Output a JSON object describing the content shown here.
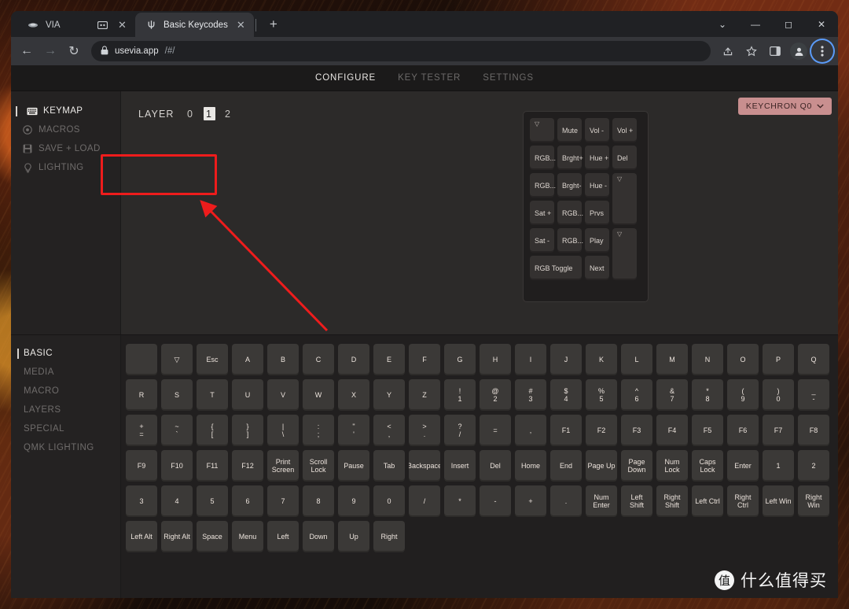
{
  "browser": {
    "tabs": [
      {
        "title": "VIA",
        "favicon": "via-icon",
        "active": false,
        "has_cast_icon": true
      },
      {
        "title": "Basic Keycodes",
        "favicon": "psi-icon",
        "active": true,
        "has_cast_icon": false
      }
    ],
    "newtab_label": "+",
    "window_controls": [
      "chevron-down",
      "minimize",
      "maximize",
      "close"
    ],
    "toolbar": {
      "back": "←",
      "forward": "→",
      "reload": "↻",
      "lock_icon": "lock-icon",
      "url_domain": "usevia.app",
      "url_path": "/#/",
      "share_icon": "share-icon",
      "star_icon": "star-icon",
      "panel_icon": "side-panel-icon",
      "profile_icon": "profile-avatar",
      "menu_icon": "three-dot-menu"
    }
  },
  "app": {
    "topnav": [
      {
        "label": "CONFIGURE",
        "active": true
      },
      {
        "label": "KEY TESTER",
        "active": false
      },
      {
        "label": "SETTINGS",
        "active": false
      }
    ],
    "sidebar": [
      {
        "label": "KEYMAP",
        "icon": "keyboard-icon",
        "active": true
      },
      {
        "label": "MACROS",
        "icon": "record-icon",
        "active": false
      },
      {
        "label": "SAVE + LOAD",
        "icon": "save-icon",
        "active": false
      },
      {
        "label": "LIGHTING",
        "icon": "bulb-icon",
        "active": false
      }
    ],
    "layer": {
      "label": "LAYER",
      "options": [
        "0",
        "1",
        "2"
      ],
      "selected": "1"
    },
    "keyboard_select": {
      "label": "KEYCHRON Q0",
      "chevron": "⌄",
      "color": "#c98f8f"
    },
    "keyboard_preview": {
      "keys": [
        {
          "label": "▽",
          "col": 0,
          "row": 0,
          "w": 1,
          "h": 1,
          "tiny": true
        },
        {
          "label": "Mute",
          "col": 1,
          "row": 0,
          "w": 1,
          "h": 1
        },
        {
          "label": "Vol -",
          "col": 2,
          "row": 0,
          "w": 1,
          "h": 1
        },
        {
          "label": "Vol +",
          "col": 3,
          "row": 0,
          "w": 1,
          "h": 1
        },
        {
          "label": "RGB...",
          "col": 0,
          "row": 1,
          "w": 1,
          "h": 1
        },
        {
          "label": "Brght+",
          "col": 1,
          "row": 1,
          "w": 1,
          "h": 1
        },
        {
          "label": "Hue +",
          "col": 2,
          "row": 1,
          "w": 1,
          "h": 1
        },
        {
          "label": "Del",
          "col": 3,
          "row": 1,
          "w": 1,
          "h": 1
        },
        {
          "label": "RGB...",
          "col": 0,
          "row": 2,
          "w": 1,
          "h": 1
        },
        {
          "label": "Brght-",
          "col": 1,
          "row": 2,
          "w": 1,
          "h": 1
        },
        {
          "label": "Hue -",
          "col": 2,
          "row": 2,
          "w": 1,
          "h": 1
        },
        {
          "label": "▽",
          "col": 3,
          "row": 2,
          "w": 1,
          "h": 2,
          "tiny": true
        },
        {
          "label": "Sat +",
          "col": 0,
          "row": 3,
          "w": 1,
          "h": 1
        },
        {
          "label": "RGB...",
          "col": 1,
          "row": 3,
          "w": 1,
          "h": 1
        },
        {
          "label": "Prvs",
          "col": 2,
          "row": 3,
          "w": 1,
          "h": 1
        },
        {
          "label": "Sat -",
          "col": 0,
          "row": 4,
          "w": 1,
          "h": 1
        },
        {
          "label": "RGB...",
          "col": 1,
          "row": 4,
          "w": 1,
          "h": 1
        },
        {
          "label": "Play",
          "col": 2,
          "row": 4,
          "w": 1,
          "h": 1
        },
        {
          "label": "▽",
          "col": 3,
          "row": 4,
          "w": 1,
          "h": 2,
          "tiny": true
        },
        {
          "label": "RGB Toggle",
          "col": 0,
          "row": 5,
          "w": 2,
          "h": 1
        },
        {
          "label": "Next",
          "col": 2,
          "row": 5,
          "w": 1,
          "h": 1
        }
      ]
    },
    "categories": [
      {
        "label": "BASIC",
        "active": true
      },
      {
        "label": "MEDIA",
        "active": false
      },
      {
        "label": "MACRO",
        "active": false
      },
      {
        "label": "LAYERS",
        "active": false
      },
      {
        "label": "SPECIAL",
        "active": false
      },
      {
        "label": "QMK LIGHTING",
        "active": false
      }
    ],
    "keycode_rows": [
      [
        {
          "top": "",
          "bottom": ""
        },
        {
          "top": "",
          "bottom": "▽"
        },
        {
          "top": "",
          "bottom": "Esc"
        },
        {
          "top": "",
          "bottom": "A"
        },
        {
          "top": "",
          "bottom": "B"
        },
        {
          "top": "",
          "bottom": "C"
        },
        {
          "top": "",
          "bottom": "D"
        },
        {
          "top": "",
          "bottom": "E"
        },
        {
          "top": "",
          "bottom": "F"
        },
        {
          "top": "",
          "bottom": "G"
        },
        {
          "top": "",
          "bottom": "H"
        },
        {
          "top": "",
          "bottom": "I"
        },
        {
          "top": "",
          "bottom": "J"
        },
        {
          "top": "",
          "bottom": "K"
        },
        {
          "top": "",
          "bottom": "L"
        },
        {
          "top": "",
          "bottom": "M"
        },
        {
          "top": "",
          "bottom": "N"
        },
        {
          "top": "",
          "bottom": "O"
        },
        {
          "top": "",
          "bottom": "P"
        },
        {
          "top": "",
          "bottom": "Q"
        }
      ],
      [
        {
          "top": "",
          "bottom": "R"
        },
        {
          "top": "",
          "bottom": "S"
        },
        {
          "top": "",
          "bottom": "T"
        },
        {
          "top": "",
          "bottom": "U"
        },
        {
          "top": "",
          "bottom": "V"
        },
        {
          "top": "",
          "bottom": "W"
        },
        {
          "top": "",
          "bottom": "X"
        },
        {
          "top": "",
          "bottom": "Y"
        },
        {
          "top": "",
          "bottom": "Z"
        },
        {
          "top": "!",
          "bottom": "1"
        },
        {
          "top": "@",
          "bottom": "2"
        },
        {
          "top": "#",
          "bottom": "3"
        },
        {
          "top": "$",
          "bottom": "4"
        },
        {
          "top": "%",
          "bottom": "5"
        },
        {
          "top": "^",
          "bottom": "6"
        },
        {
          "top": "&",
          "bottom": "7"
        },
        {
          "top": "*",
          "bottom": "8"
        },
        {
          "top": "(",
          "bottom": "9"
        },
        {
          "top": ")",
          "bottom": "0"
        },
        {
          "top": "_",
          "bottom": "-"
        }
      ],
      [
        {
          "top": "+",
          "bottom": "="
        },
        {
          "top": "~",
          "bottom": "`"
        },
        {
          "top": "{",
          "bottom": "["
        },
        {
          "top": "}",
          "bottom": "]"
        },
        {
          "top": "|",
          "bottom": "\\"
        },
        {
          "top": ":",
          "bottom": ";"
        },
        {
          "top": "\"",
          "bottom": "'"
        },
        {
          "top": "<",
          "bottom": ","
        },
        {
          "top": ">",
          "bottom": "."
        },
        {
          "top": "?",
          "bottom": "/"
        },
        {
          "top": "",
          "bottom": "="
        },
        {
          "top": "",
          "bottom": ","
        },
        {
          "top": "",
          "bottom": "F1"
        },
        {
          "top": "",
          "bottom": "F2"
        },
        {
          "top": "",
          "bottom": "F3"
        },
        {
          "top": "",
          "bottom": "F4"
        },
        {
          "top": "",
          "bottom": "F5"
        },
        {
          "top": "",
          "bottom": "F6"
        },
        {
          "top": "",
          "bottom": "F7"
        },
        {
          "top": "",
          "bottom": "F8"
        }
      ],
      [
        {
          "top": "",
          "bottom": "F9"
        },
        {
          "top": "",
          "bottom": "F10"
        },
        {
          "top": "",
          "bottom": "F11"
        },
        {
          "top": "",
          "bottom": "F12"
        },
        {
          "top": "Print",
          "bottom": "Screen"
        },
        {
          "top": "Scroll",
          "bottom": "Lock"
        },
        {
          "top": "",
          "bottom": "Pause"
        },
        {
          "top": "",
          "bottom": "Tab"
        },
        {
          "top": "",
          "bottom": "Backspace"
        },
        {
          "top": "",
          "bottom": "Insert"
        },
        {
          "top": "",
          "bottom": "Del"
        },
        {
          "top": "",
          "bottom": "Home"
        },
        {
          "top": "",
          "bottom": "End"
        },
        {
          "top": "",
          "bottom": "Page Up"
        },
        {
          "top": "Page",
          "bottom": "Down"
        },
        {
          "top": "Num",
          "bottom": "Lock"
        },
        {
          "top": "Caps",
          "bottom": "Lock"
        },
        {
          "top": "",
          "bottom": "Enter"
        },
        {
          "top": "",
          "bottom": "1"
        },
        {
          "top": "",
          "bottom": "2"
        }
      ],
      [
        {
          "top": "",
          "bottom": "3"
        },
        {
          "top": "",
          "bottom": "4"
        },
        {
          "top": "",
          "bottom": "5"
        },
        {
          "top": "",
          "bottom": "6"
        },
        {
          "top": "",
          "bottom": "7"
        },
        {
          "top": "",
          "bottom": "8"
        },
        {
          "top": "",
          "bottom": "9"
        },
        {
          "top": "",
          "bottom": "0"
        },
        {
          "top": "",
          "bottom": "/"
        },
        {
          "top": "",
          "bottom": "*"
        },
        {
          "top": "",
          "bottom": "-"
        },
        {
          "top": "",
          "bottom": "+"
        },
        {
          "top": "",
          "bottom": "."
        },
        {
          "top": "Num",
          "bottom": "Enter"
        },
        {
          "top": "Left",
          "bottom": "Shift"
        },
        {
          "top": "Right",
          "bottom": "Shift"
        },
        {
          "top": "",
          "bottom": "Left Ctrl"
        },
        {
          "top": "Right",
          "bottom": "Ctrl"
        },
        {
          "top": "",
          "bottom": "Left Win"
        },
        {
          "top": "Right",
          "bottom": "Win"
        }
      ],
      [
        {
          "top": "",
          "bottom": "Left Alt"
        },
        {
          "top": "",
          "bottom": "Right Alt"
        },
        {
          "top": "",
          "bottom": "Space"
        },
        {
          "top": "",
          "bottom": "Menu"
        },
        {
          "top": "",
          "bottom": "Left"
        },
        {
          "top": "",
          "bottom": "Down"
        },
        {
          "top": "",
          "bottom": "Up"
        },
        {
          "top": "",
          "bottom": "Right"
        }
      ]
    ]
  },
  "annotation": {
    "box_color": "#ee1c1c",
    "arrow_color": "#ee1c1c"
  },
  "watermark": {
    "badge": "值",
    "text": "什么值得买"
  }
}
